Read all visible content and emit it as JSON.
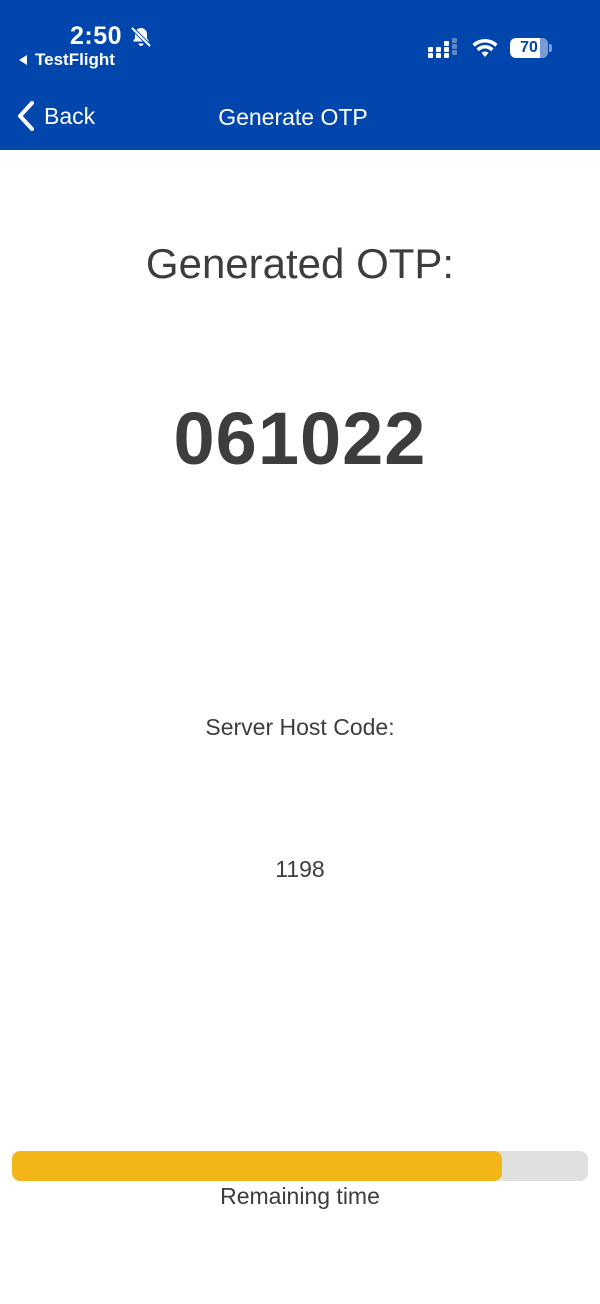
{
  "status_bar": {
    "time": "2:50",
    "back_app_label": "TestFlight",
    "battery_level": "70",
    "icons": [
      "bell-slash-icon",
      "cellular-signal-icon",
      "wifi-icon",
      "battery-icon"
    ]
  },
  "nav": {
    "back_label": "Back",
    "title": "Generate OTP"
  },
  "content": {
    "heading": "Generated OTP:",
    "otp_code": "061022",
    "server_host_label": "Server Host Code:",
    "server_host_value": "1198"
  },
  "timer": {
    "label": "Remaining time",
    "progress_fraction": 0.85
  },
  "colors": {
    "header_blue": "#0046ad",
    "progress_yellow": "#f3b619",
    "progress_track": "#e0e0e0",
    "text_dark": "#3d3d3d"
  }
}
